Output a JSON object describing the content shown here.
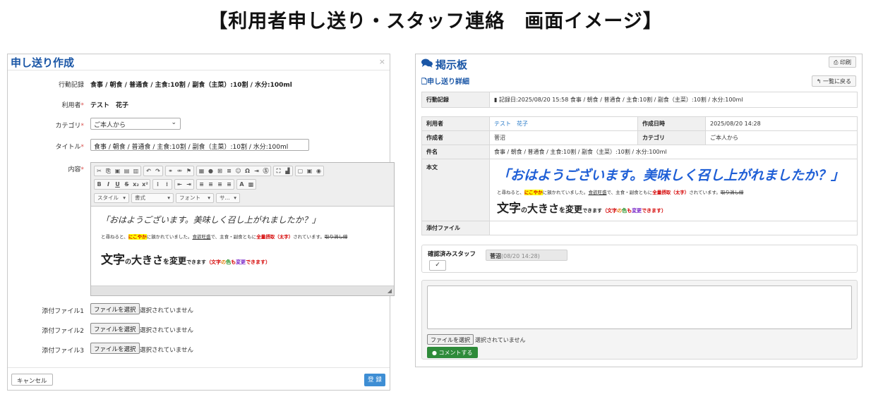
{
  "page_title": "【利用者申し送り・スタッフ連絡　画面イメージ】",
  "left": {
    "title": "申し送り作成",
    "close": "×",
    "action_log_label": "行動記録",
    "action_log_value": "食事 / 朝食 / 普通食 / 主食:10割 / 副食（主菜）:10割 / 水分:100ml",
    "user_label": "利用者",
    "user_value": "テスト　花子",
    "category_label": "カテゴリ",
    "category_value": "ご本人から",
    "title_label": "タイトル",
    "title_value": "食事 / 朝食 / 普通食 / 主食:10割 / 副食（主菜）:10割 / 水分:100ml",
    "content_label": "内容",
    "required_mark": "*",
    "toolbar": {
      "row1": [
        "✂",
        "⎘",
        "▣",
        "▤",
        "▥",
        "↶",
        "↷",
        "⚭",
        "⚮",
        "⚑",
        "▦",
        "●",
        "⊞",
        "≡",
        "☺",
        "Ω",
        "⇥",
        "Ⓢ",
        "⛶",
        "▟",
        "▢",
        "▣",
        "◉"
      ],
      "row2": [
        "B",
        "I",
        "U",
        "S",
        "x₂",
        "x²",
        "⁝",
        "⁞",
        "⇤",
        "⇥",
        "≡",
        "≡",
        "≡",
        "≡",
        "A",
        "▩"
      ],
      "style_combo": "スタイル",
      "format_combo": "書式",
      "font_combo": "フォント",
      "size_combo": "サ..."
    },
    "content": {
      "quote": "「おはようございます。美味しく召し上がれましたか？」",
      "l1_a": "と尋ねると、",
      "l1_b": "にこやか",
      "l1_c": "に頷かれていました。",
      "l1_d": "食欲旺盛",
      "l1_e": "で、主食・副食ともに",
      "l1_f": "全量摂取（太字）",
      "l1_g": "されています。",
      "l1_h": "取り消し線",
      "l2_a": "文字",
      "l2_b": "の",
      "l2_c": "大きさ",
      "l2_d": "を",
      "l2_e": "変更",
      "l2_f": "できます",
      "l2_g1": "（文字",
      "l2_g2": "の",
      "l2_g3": "色",
      "l2_g4": "も",
      "l2_g5": "変更",
      "l2_g6": "できます）"
    },
    "files": [
      {
        "label": "添付ファイル1",
        "button": "ファイルを選択",
        "status": "選択されていません"
      },
      {
        "label": "添付ファイル2",
        "button": "ファイルを選択",
        "status": "選択されていません"
      },
      {
        "label": "添付ファイル3",
        "button": "ファイルを選択",
        "status": "選択されていません"
      }
    ],
    "cancel": "キャンセル",
    "submit": "登 録"
  },
  "right": {
    "title": "掲示板",
    "print": "印刷",
    "subtitle": "申し送り詳細",
    "back": "一覧に戻る",
    "action_log_label": "行動記録",
    "action_log_value": "記録日:2025/08/20 15:58 食事 / 朝食 / 普通食 / 主食:10割 / 副食（主菜）:10割 / 水分:100ml",
    "user_label": "利用者",
    "user_value": "テスト　花子",
    "created_label": "作成日時",
    "created_value": "2025/08/20 14:28",
    "author_label": "作成者",
    "author_value": "菅沼",
    "category_label": "カテゴリ",
    "category_value": "ご本人から",
    "subject_label": "件名",
    "subject_value": "食事 / 朝食 / 普通食 / 主食:10割 / 副食（主菜）:10割 / 水分:100ml",
    "body_label": "本文",
    "attach_label": "添付ファイル",
    "confirm_label": "確認済みスタッフ",
    "confirm_check": "✓",
    "confirm_name": "菅沼",
    "confirm_time": "(08/20 14:28)",
    "file_button": "ファイルを選択",
    "file_status": "選択されていません",
    "comment_button": "コメントする"
  }
}
